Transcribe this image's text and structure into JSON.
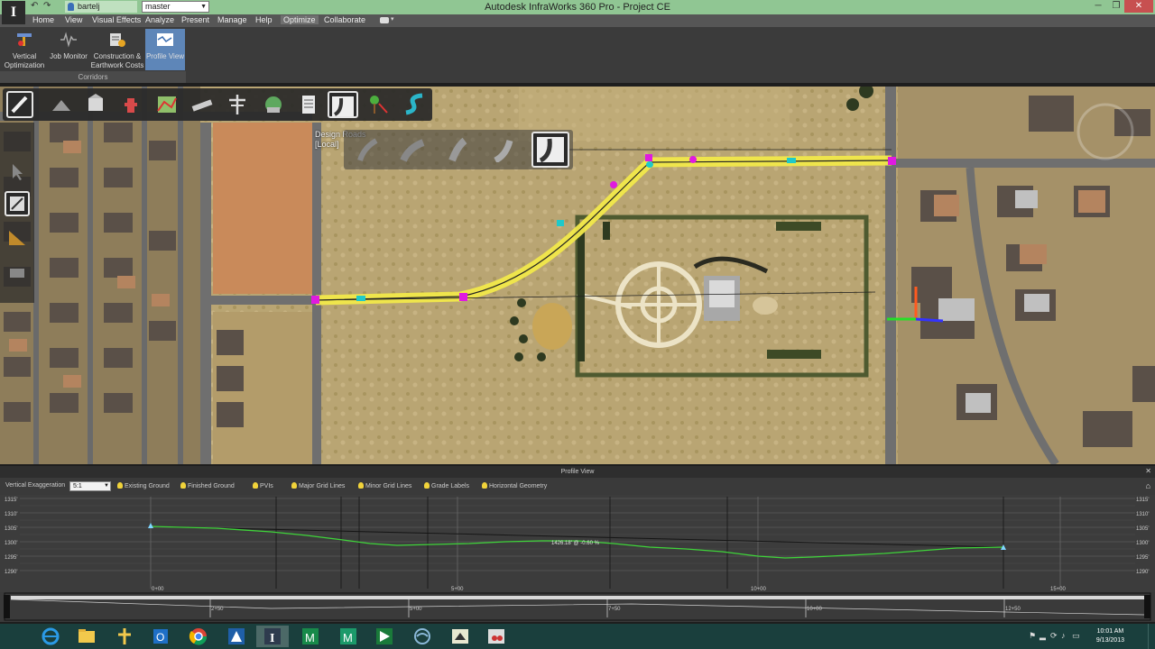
{
  "window": {
    "title": "Autodesk InfraWorks 360 Pro - Project CE",
    "logo_letter": "I",
    "username": "bartelj",
    "branch": "master",
    "controls": {
      "minimize": "─",
      "maximize": "❐",
      "close": "✕"
    }
  },
  "menu": {
    "items": [
      {
        "label": "Home"
      },
      {
        "label": "View"
      },
      {
        "label": "Visual Effects"
      },
      {
        "label": "Analyze"
      },
      {
        "label": "Present"
      },
      {
        "label": "Manage"
      },
      {
        "label": "Help"
      },
      {
        "label": "Optimize"
      },
      {
        "label": "Collaborate"
      }
    ],
    "active": "Optimize"
  },
  "ribbon": {
    "buttons": [
      {
        "label_line1": "Vertical",
        "label_line2": "Optimization"
      },
      {
        "label_line1": "Job Monitor",
        "label_line2": ""
      },
      {
        "label_line1": "Construction &",
        "label_line2": "Earthwork Costs"
      },
      {
        "label_line1": "Profile View",
        "label_line2": ""
      }
    ],
    "panel_label": "Corridors",
    "active_button": "Profile View"
  },
  "viewport": {
    "tooltip_line1": "Design Roads",
    "tooltip_line2": "[Local]",
    "colors": {
      "road_highlight": "#f1e84a",
      "node_magenta": "#e01ae0",
      "node_cyan": "#1fc9c9",
      "ground": "#b8a373"
    }
  },
  "profile_view": {
    "title": "Profile View",
    "vertical_exaggeration_label": "Vertical Exaggeration",
    "vertical_exaggeration_value": "5:1",
    "toggles": [
      {
        "label": "Existing Ground"
      },
      {
        "label": "Finished Ground"
      },
      {
        "label": "PVIs"
      },
      {
        "label": "Major Grid Lines"
      },
      {
        "label": "Minor Grid Lines"
      },
      {
        "label": "Grade Labels"
      },
      {
        "label": "Horizontal Geometry"
      }
    ],
    "elevation_labels": [
      "1315'",
      "1310'",
      "1305'",
      "1300'",
      "1295'",
      "1290'"
    ],
    "station_labels": [
      "0+00",
      "5+00",
      "10+00",
      "15+00"
    ],
    "lower_station_labels": [
      "2+50",
      "5+00",
      "7+50",
      "10+00",
      "12+50"
    ],
    "grade_label": "1426.18' @ -0.60 %",
    "colors": {
      "existing_ground": "#3fd43a",
      "finished_ground": "#1a1a1a",
      "pvi": "#7fd6ff"
    }
  },
  "taskbar": {
    "apps": [
      {
        "icon": "internet-explorer-icon"
      },
      {
        "icon": "file-explorer-icon"
      },
      {
        "icon": "pin-app-icon"
      },
      {
        "icon": "outlook-icon"
      },
      {
        "icon": "chrome-icon"
      },
      {
        "icon": "autocad-icon"
      },
      {
        "icon": "infraworks-icon"
      },
      {
        "icon": "civil3d-icon"
      },
      {
        "icon": "map3d-icon"
      },
      {
        "icon": "navisworks-icon"
      },
      {
        "icon": "network-icon"
      },
      {
        "icon": "viewer-icon"
      },
      {
        "icon": "snipping-tool-icon"
      }
    ],
    "active_app": "infraworks-icon",
    "time": "10:01 AM",
    "date": "9/13/2013"
  }
}
